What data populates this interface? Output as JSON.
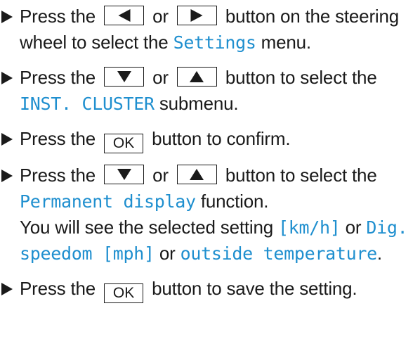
{
  "colors": {
    "text": "#1a1a1a",
    "display_text": "#1f8fcf"
  },
  "icons": {
    "bullet": "right-pointing-triangle",
    "key_left": "left-triangle",
    "key_right": "right-triangle",
    "key_down": "down-triangle",
    "key_up": "up-triangle"
  },
  "steps": [
    {
      "t1": "Press the",
      "t2": "or",
      "t3": "button on the steering wheel to select the",
      "display": "Settings",
      "t4": "menu."
    },
    {
      "t1": "Press the",
      "t2": "or",
      "t3": "button to select the",
      "display": "INST. CLUSTER",
      "t4": "submenu."
    },
    {
      "t1": "Press the",
      "key": "OK",
      "t2": "button to confirm."
    },
    {
      "t1": "Press the",
      "t2": "or",
      "t3": "button to select the",
      "display": "Permanent display",
      "t4": "function.",
      "t5": "You will see the selected setting",
      "d2": "[km/h]",
      "t6": "or",
      "d3": "Dig. speedom [mph]",
      "t7": "or",
      "d4": "outside temperature",
      "t8": "."
    },
    {
      "t1": "Press the",
      "key": "OK",
      "t2": "button to save the setting."
    }
  ]
}
